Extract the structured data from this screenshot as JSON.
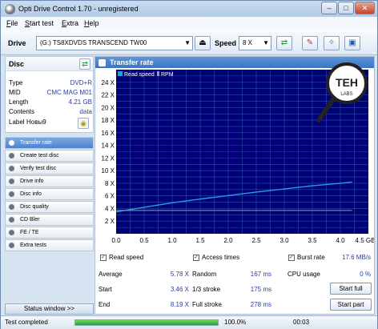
{
  "window": {
    "title": "Opti Drive Control 1.70 - unregistered",
    "minimize": "–",
    "maximize": "□",
    "close": "✕"
  },
  "menu": [
    "File",
    "Start test",
    "Extra",
    "Help"
  ],
  "toolbar": {
    "drive_label": "Drive",
    "drive_value": "(G:)   TS8XDVDS TRANSCEND TW00",
    "speed_label": "Speed",
    "speed_value": "8 X"
  },
  "disc": {
    "title": "Disc",
    "rows": [
      {
        "key": "Type",
        "value": "DVD+R"
      },
      {
        "key": "MID",
        "value": "CMC MAG M01"
      },
      {
        "key": "Length",
        "value": "4.21 GB"
      },
      {
        "key": "Contents",
        "value": "data"
      },
      {
        "key": "Label",
        "value": "Новы9"
      }
    ]
  },
  "tests": [
    "Transfer rate",
    "Create test disc",
    "Verify test disc",
    "Drive info",
    "Disc info",
    "Disc quality",
    "CD Bler",
    "FE / TE",
    "Extra tests"
  ],
  "status_window": "Status window >>",
  "panel_title": "Transfer rate",
  "legend": {
    "read_speed": "Read speed",
    "rpm": "RPM"
  },
  "chart_data": {
    "type": "line",
    "y_ticks": [
      "2 X",
      "4 X",
      "6 X",
      "8 X",
      "10 X",
      "12 X",
      "14 X",
      "16 X",
      "18 X",
      "20 X",
      "22 X",
      "24 X"
    ],
    "x_ticks": [
      "0.0",
      "0.5",
      "1.0",
      "1.5",
      "2.0",
      "2.5",
      "3.0",
      "3.5",
      "4.0",
      "4.5 GB"
    ],
    "xlim": [
      0,
      4.5
    ],
    "ylim": [
      0,
      26
    ],
    "series": [
      {
        "name": "Read speed",
        "color": "#24a0d7",
        "x": [
          0.0,
          0.5,
          1.0,
          1.5,
          2.0,
          2.5,
          3.0,
          3.5,
          4.0,
          4.21
        ],
        "y": [
          3.46,
          4.2,
          4.9,
          5.5,
          6.05,
          6.6,
          7.1,
          7.6,
          8.0,
          8.19
        ]
      },
      {
        "name": "RPM",
        "color": "#8aa0c8",
        "x": [
          0.0,
          4.21
        ],
        "y": [
          3.7,
          3.7
        ]
      }
    ],
    "grid": true
  },
  "stats": {
    "read_speed_label": "Read speed",
    "average_label": "Average",
    "average": "5.78 X",
    "start_label": "Start",
    "start": "3.46 X",
    "end_label": "End",
    "end": "8.19 X",
    "access_label": "Access times",
    "random_label": "Random",
    "random": "167 ms",
    "one_third_label": "1/3 stroke",
    "one_third": "175 ms",
    "full_label": "Full stroke",
    "full": "278 ms",
    "burst_label": "Burst rate",
    "burst": "17.6 MB/s",
    "cpu_label": "CPU usage",
    "cpu": "0 %",
    "start_full": "Start full",
    "start_part": "Start part"
  },
  "statusbar": {
    "text": "Test completed",
    "progress": "100.0%",
    "progress_fraction": 1.0,
    "time": "00:03"
  },
  "colors": {
    "accent": "#3b75c3",
    "chart_bg": "#000078",
    "grid": "#2a4fa0",
    "progress": "#20a32b"
  }
}
